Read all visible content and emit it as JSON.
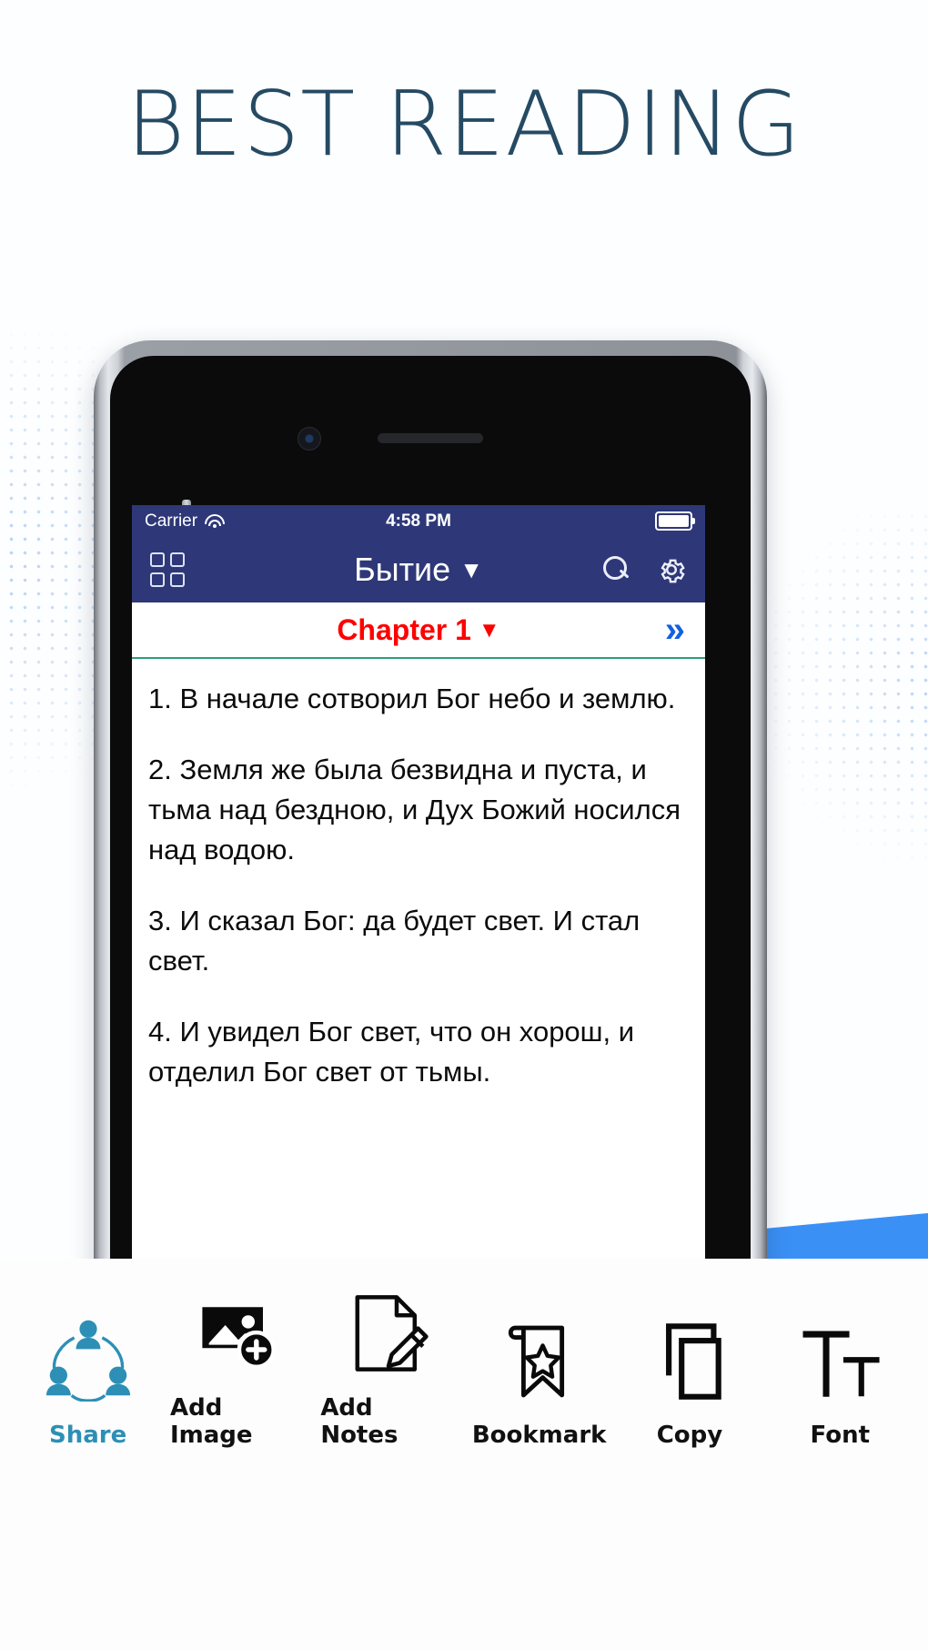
{
  "headline": "BEST READING",
  "theme": {
    "headline_color": "#254a63",
    "navbar_color": "#2e3878",
    "chapter_color": "#fe0000",
    "divider_color": "#2f9e78",
    "wave_color": "#3b90f5",
    "accent_color": "#2d8fb5",
    "chevron_color": "#1560e0"
  },
  "phone": {
    "statusbar": {
      "carrier": "Carrier",
      "wifi_icon": "wifi-icon",
      "time": "4:58 PM",
      "battery_icon": "battery-full-icon"
    },
    "navbar": {
      "grid_icon": "grid-squares-icon",
      "title": "Бытие",
      "title_caret": "▼",
      "search_icon": "search-icon",
      "settings_icon": "gear-icon"
    },
    "chapterbar": {
      "label": "Chapter 1",
      "caret": "▼",
      "next_icon": "»"
    },
    "verses": [
      "1. В начале сотворил Бог небо и землю.",
      "2. Земля же была безвидна и пуста, и тьма над бездною, и Дух Божий носился над водою.",
      "3. И сказал Бог: да будет свет. И стал свет.",
      "4. И увидел Бог свет, что он хорош, и отделил Бог свет от тьмы."
    ]
  },
  "toolbar": {
    "items": [
      {
        "label": "Share",
        "icon": "share-people-icon",
        "accent": true
      },
      {
        "label": "Add Image",
        "icon": "add-image-icon",
        "accent": false
      },
      {
        "label": "Add Notes",
        "icon": "note-pencil-icon",
        "accent": false
      },
      {
        "label": "Bookmark",
        "icon": "bookmark-star-icon",
        "accent": false
      },
      {
        "label": "Copy",
        "icon": "copy-icon",
        "accent": false
      },
      {
        "label": "Font",
        "icon": "font-size-icon",
        "accent": false
      }
    ]
  }
}
